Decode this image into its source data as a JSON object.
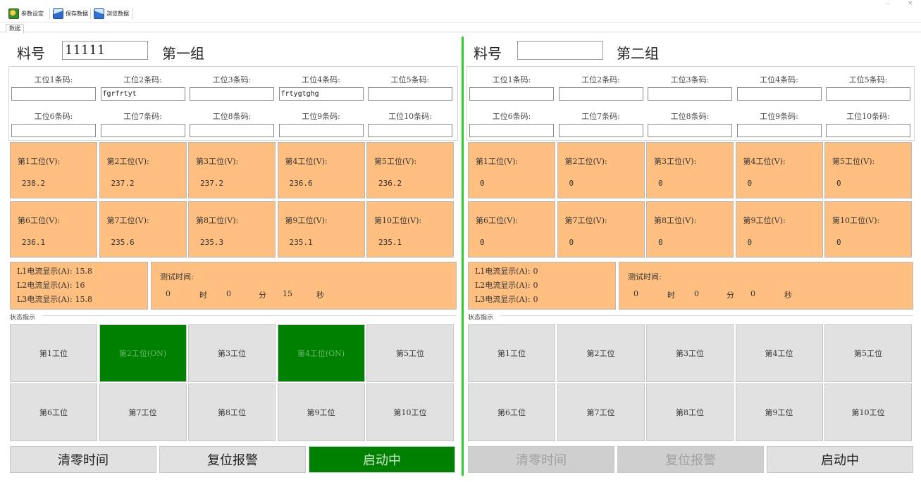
{
  "toolbar": {
    "items": [
      {
        "label": "参数设定",
        "icon": "settings-icon"
      },
      {
        "label": "保存数据",
        "icon": "save-icon"
      },
      {
        "label": "浏览数据",
        "icon": "browse-icon"
      }
    ]
  },
  "tabs": [
    {
      "label": "数据"
    }
  ],
  "left": {
    "part_label": "料号",
    "part_value": "11111",
    "group_title": "第一组",
    "barcodes": [
      {
        "label": "工位1条码:",
        "value": ""
      },
      {
        "label": "工位2条码:",
        "value": "fgrfrtyt"
      },
      {
        "label": "工位3条码:",
        "value": ""
      },
      {
        "label": "工位4条码:",
        "value": "frtygtghg"
      },
      {
        "label": "工位5条码:",
        "value": ""
      },
      {
        "label": "工位6条码:",
        "value": ""
      },
      {
        "label": "工位7条码:",
        "value": ""
      },
      {
        "label": "工位8条码:",
        "value": ""
      },
      {
        "label": "工位9条码:",
        "value": ""
      },
      {
        "label": "工位10条码:",
        "value": ""
      }
    ],
    "voltages": [
      {
        "label": "第1工位(V):",
        "value": "238.2"
      },
      {
        "label": "第2工位(V):",
        "value": "237.2"
      },
      {
        "label": "第3工位(V):",
        "value": "237.2"
      },
      {
        "label": "第4工位(V):",
        "value": "236.6"
      },
      {
        "label": "第5工位(V):",
        "value": "236.2"
      },
      {
        "label": "第6工位(V):",
        "value": "236.1"
      },
      {
        "label": "第7工位(V):",
        "value": "235.6"
      },
      {
        "label": "第8工位(V):",
        "value": "235.3"
      },
      {
        "label": "第9工位(V):",
        "value": "235.1"
      },
      {
        "label": "第10工位(V):",
        "value": "235.1"
      }
    ],
    "currents": [
      {
        "label": "L1电流显示(A):",
        "value": "15.8"
      },
      {
        "label": "L2电流显示(A):",
        "value": "16"
      },
      {
        "label": "L3电流显示(A):",
        "value": "15.8"
      }
    ],
    "test_time": {
      "label": "测试时间:",
      "hours": "0",
      "hours_unit": "时",
      "minutes": "0",
      "minutes_unit": "分",
      "seconds": "15",
      "seconds_unit": "秒"
    },
    "status_title": "状态指示",
    "stations": [
      {
        "label": "第1工位",
        "on": false
      },
      {
        "label": "第2工位(ON)",
        "on": true
      },
      {
        "label": "第3工位",
        "on": false
      },
      {
        "label": "第4工位(ON)",
        "on": true
      },
      {
        "label": "第5工位",
        "on": false
      },
      {
        "label": "第6工位",
        "on": false
      },
      {
        "label": "第7工位",
        "on": false
      },
      {
        "label": "第8工位",
        "on": false
      },
      {
        "label": "第9工位",
        "on": false
      },
      {
        "label": "第10工位",
        "on": false
      }
    ],
    "buttons": [
      {
        "label": "清零时间",
        "state": "normal"
      },
      {
        "label": "复位报警",
        "state": "normal"
      },
      {
        "label": "启动中",
        "state": "running"
      }
    ]
  },
  "right": {
    "part_label": "料号",
    "part_value": "",
    "group_title": "第二组",
    "barcodes": [
      {
        "label": "工位1条码:",
        "value": ""
      },
      {
        "label": "工位2条码:",
        "value": ""
      },
      {
        "label": "工位3条码:",
        "value": ""
      },
      {
        "label": "工位4条码:",
        "value": ""
      },
      {
        "label": "工位5条码:",
        "value": ""
      },
      {
        "label": "工位6条码:",
        "value": ""
      },
      {
        "label": "工位7条码:",
        "value": ""
      },
      {
        "label": "工位8条码:",
        "value": ""
      },
      {
        "label": "工位9条码:",
        "value": ""
      },
      {
        "label": "工位10条码:",
        "value": ""
      }
    ],
    "voltages": [
      {
        "label": "第1工位(V):",
        "value": "0"
      },
      {
        "label": "第2工位(V):",
        "value": "0"
      },
      {
        "label": "第3工位(V):",
        "value": "0"
      },
      {
        "label": "第4工位(V):",
        "value": "0"
      },
      {
        "label": "第5工位(V):",
        "value": "0"
      },
      {
        "label": "第6工位(V):",
        "value": "0"
      },
      {
        "label": "第7工位(V):",
        "value": "0"
      },
      {
        "label": "第8工位(V):",
        "value": "0"
      },
      {
        "label": "第9工位(V):",
        "value": "0"
      },
      {
        "label": "第10工位(V):",
        "value": "0"
      }
    ],
    "currents": [
      {
        "label": "L1电流显示(A):",
        "value": "0"
      },
      {
        "label": "L2电流显示(A):",
        "value": "0"
      },
      {
        "label": "L3电流显示(A):",
        "value": "0"
      }
    ],
    "test_time": {
      "label": "测试时间:",
      "hours": "0",
      "hours_unit": "时",
      "minutes": "0",
      "minutes_unit": "分",
      "seconds": "0",
      "seconds_unit": "秒"
    },
    "status_title": "状态指示",
    "stations": [
      {
        "label": "第1工位",
        "on": false
      },
      {
        "label": "第2工位",
        "on": false
      },
      {
        "label": "第3工位",
        "on": false
      },
      {
        "label": "第4工位",
        "on": false
      },
      {
        "label": "第5工位",
        "on": false
      },
      {
        "label": "第6工位",
        "on": false
      },
      {
        "label": "第7工位",
        "on": false
      },
      {
        "label": "第8工位",
        "on": false
      },
      {
        "label": "第9工位",
        "on": false
      },
      {
        "label": "第10工位",
        "on": false
      }
    ],
    "buttons": [
      {
        "label": "清零时间",
        "state": "disabled"
      },
      {
        "label": "复位报警",
        "state": "disabled"
      },
      {
        "label": "启动中",
        "state": "normal"
      }
    ]
  }
}
